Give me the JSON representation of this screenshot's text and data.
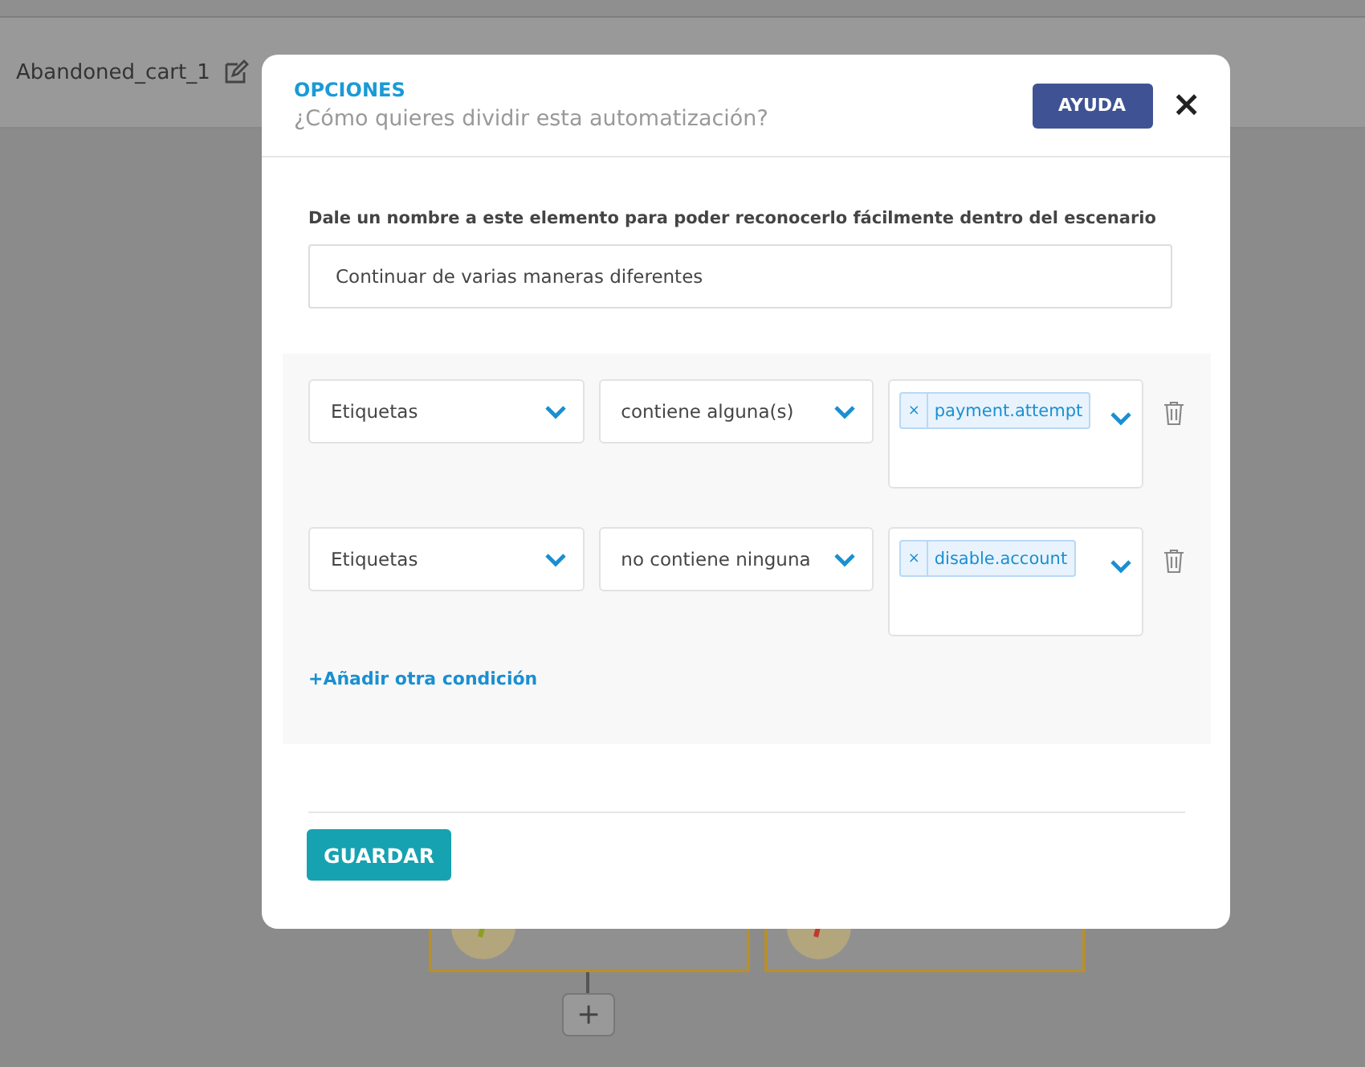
{
  "header": {
    "title": "Abandoned_cart_1"
  },
  "canvas": {
    "nodes": [
      {
        "kind": "ok"
      },
      {
        "kind": "error"
      }
    ],
    "add_button": "+"
  },
  "modal": {
    "eyebrow": "OPCIONES",
    "title": "¿Cómo quieres dividir esta automatización?",
    "help_button": "AYUDA",
    "close": "×",
    "name_label": "Dale un nombre a este elemento para poder reconocerlo fácilmente dentro del escenario",
    "name_value": "Continuar de varias maneras diferentes",
    "conditions": [
      {
        "field": "Etiquetas",
        "operator": "contiene alguna(s)",
        "tags": [
          {
            "remove": "×",
            "label": "payment.attempt"
          }
        ]
      },
      {
        "field": "Etiquetas",
        "operator": "no contiene ninguna",
        "tags": [
          {
            "remove": "×",
            "label": "disable.account"
          }
        ]
      }
    ],
    "add_condition": "+Añadir otra condición",
    "save_button": "GUARDAR"
  }
}
